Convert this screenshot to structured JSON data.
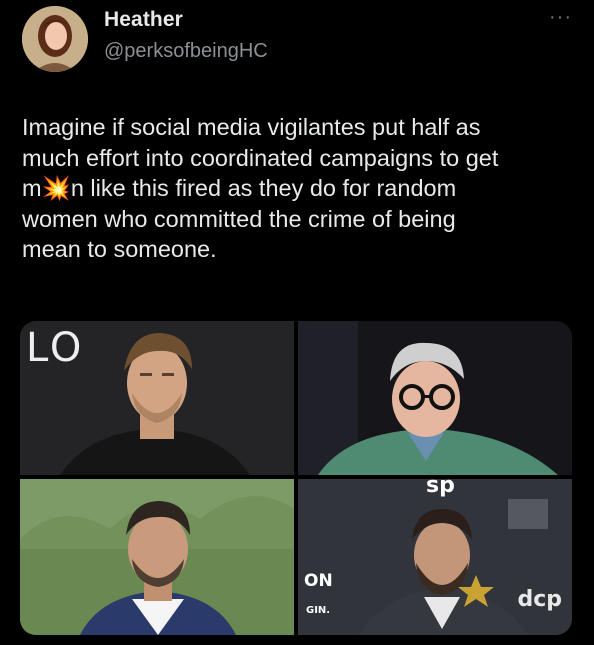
{
  "tweet": {
    "author_name": "Heather",
    "author_handle": "@perksofbeingHC",
    "more_label": "···",
    "text_lines": [
      "Imagine if social media vigilantes put half as",
      "much effort into coordinated campaigns to get",
      "m💥n like this fired as they do for random",
      "women who committed the crime of being",
      "mean to someone."
    ]
  },
  "media": {
    "overlays": {
      "tile1_sign": "LO",
      "tile3_sign_top": "ON",
      "tile3_sign_bottom": "GIN.",
      "tile4_logo": "dcp",
      "tile4_top": "sp"
    }
  },
  "colors": {
    "background": "#000000",
    "text_primary": "#e7e9ea",
    "text_secondary": "#8b9095"
  }
}
